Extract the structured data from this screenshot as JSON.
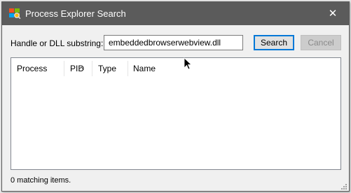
{
  "window": {
    "title": "Process Explorer Search",
    "close_glyph": "✕",
    "app_icon": "process-explorer-icon"
  },
  "search": {
    "label": "Handle or DLL substring:",
    "value": "embeddedbrowserwebview.dll",
    "search_button": "Search",
    "cancel_button": "Cancel"
  },
  "results": {
    "columns": [
      {
        "label": "Process"
      },
      {
        "label": "PID",
        "sorted": true
      },
      {
        "label": "Type"
      },
      {
        "label": "Name"
      }
    ],
    "rows": []
  },
  "status": {
    "text": "0 matching items."
  },
  "colors": {
    "titlebar": "#5b5b5b",
    "accent_border": "#0078d7"
  }
}
